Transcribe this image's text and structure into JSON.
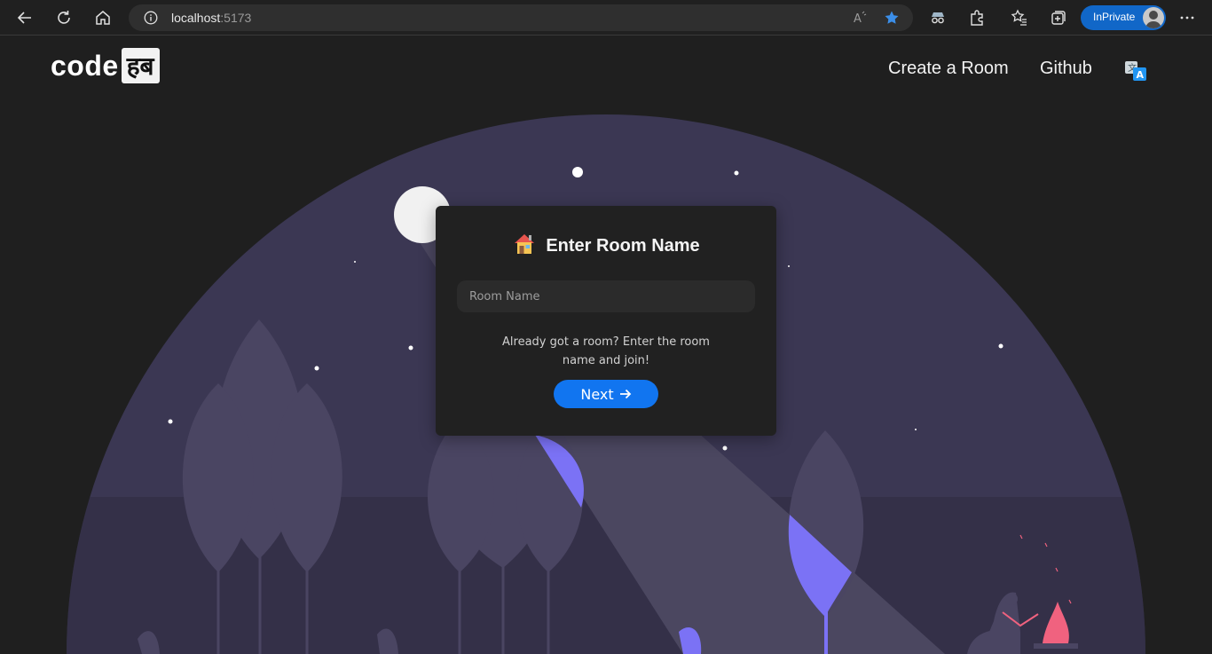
{
  "browser": {
    "url_host": "localhost",
    "url_port": ":5173",
    "inprivate_label": "InPrivate"
  },
  "site": {
    "logo_left": "code",
    "logo_right": "हब",
    "nav": {
      "create_room": "Create a Room",
      "github": "Github"
    }
  },
  "card": {
    "icon": "house-icon",
    "title": "Enter Room Name",
    "input_placeholder": "Room Name",
    "input_value": "",
    "helper_text": "Already got a room? Enter the room name and join!",
    "next_label": "Next"
  },
  "colors": {
    "page_bg": "#1f1f1f",
    "scene_circle": "#3b3753",
    "accent_purple": "#7b72f5",
    "button_blue": "#1175f0",
    "fire_pink": "#f0627f"
  }
}
